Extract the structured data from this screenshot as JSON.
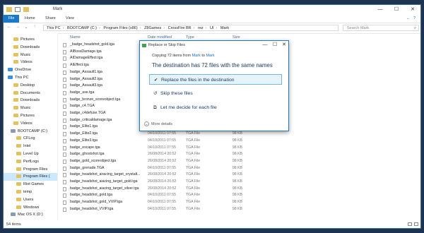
{
  "window": {
    "title": "Mark",
    "controls": {
      "minimize": "—",
      "maximize": "☐",
      "close": "✕"
    }
  },
  "ribbon": {
    "tabs": [
      "File",
      "Home",
      "Share",
      "View"
    ]
  },
  "addressbar": {
    "back": "←",
    "forward": "→",
    "up": "↑",
    "path": [
      "This PC",
      "BOOTCAMP (C:)",
      "Program Files (x86)",
      "Z8Games",
      "CrossFire BR",
      "rez",
      "UI",
      "Mark"
    ],
    "search_placeholder": "Search Mark"
  },
  "nav": {
    "items": [
      {
        "label": "Pictures",
        "icon": "folder"
      },
      {
        "label": "Downloads",
        "icon": "folder"
      },
      {
        "label": "Music",
        "icon": "folder"
      },
      {
        "label": "Videos",
        "icon": "folder"
      },
      {
        "label": "OneDrive",
        "icon": "cloud"
      },
      {
        "label": "This PC",
        "icon": "pc"
      },
      {
        "label": "Desktop",
        "icon": "folder"
      },
      {
        "label": "Documents",
        "icon": "folder"
      },
      {
        "label": "Downloads",
        "icon": "folder"
      },
      {
        "label": "Music",
        "icon": "folder"
      },
      {
        "label": "Pictures",
        "icon": "folder"
      },
      {
        "label": "Videos",
        "icon": "folder"
      },
      {
        "label": "BOOTCAMP (C:)",
        "icon": "drive"
      },
      {
        "label": "CFLog",
        "icon": "folder"
      },
      {
        "label": "Intel",
        "icon": "folder"
      },
      {
        "label": "Level Up",
        "icon": "folder"
      },
      {
        "label": "PerfLogs",
        "icon": "folder"
      },
      {
        "label": "Program Files",
        "icon": "folder"
      },
      {
        "label": "Program Files (",
        "icon": "folder",
        "selected": true
      },
      {
        "label": "Riot Games",
        "icon": "folder"
      },
      {
        "label": "temp",
        "icon": "folder"
      },
      {
        "label": "Users",
        "icon": "folder"
      },
      {
        "label": "Windows",
        "icon": "folder"
      },
      {
        "label": "Mac OS X (D:)",
        "icon": "drive"
      }
    ]
  },
  "columns": {
    "name": "Name",
    "date": "Date modified",
    "type": "Type",
    "size": "Size"
  },
  "files": [
    {
      "name": "_badge_headshot_gold.tga",
      "date": "",
      "type": "",
      "size": ""
    },
    {
      "name": "AIBossDamage.tga",
      "date": "",
      "type": "",
      "size": ""
    },
    {
      "name": "AIDamageEffect.tga",
      "date": "",
      "type": "",
      "size": ""
    },
    {
      "name": "AIEffect.tga",
      "date": "",
      "type": "",
      "size": ""
    },
    {
      "name": "badge_Assault1.tga",
      "date": "",
      "type": "",
      "size": ""
    },
    {
      "name": "badge_Assault2.tga",
      "date": "",
      "type": "",
      "size": ""
    },
    {
      "name": "badge_Assault3.tga",
      "date": "",
      "type": "",
      "size": ""
    },
    {
      "name": "badge_axe.tga",
      "date": "",
      "type": "",
      "size": ""
    },
    {
      "name": "badge_bronze_scoreobject.tga",
      "date": "",
      "type": "",
      "size": ""
    },
    {
      "name": "badge_c4.TGA",
      "date": "",
      "type": "",
      "size": ""
    },
    {
      "name": "badge_c4defuse.TGA",
      "date": "",
      "type": "",
      "size": ""
    },
    {
      "name": "badge_criticaldamage.tga",
      "date": "",
      "type": "",
      "size": ""
    },
    {
      "name": "badge_Elite1.tga",
      "date": "",
      "type": "",
      "size": ""
    },
    {
      "name": "badge_Elite2.tga",
      "date": "04/10/2011 07:55",
      "type": "TGA File",
      "size": "98 KB"
    },
    {
      "name": "badge_Elite3.tga",
      "date": "04/10/2011 07:55",
      "type": "TGA File",
      "size": "98 KB"
    },
    {
      "name": "badge_escape.tga",
      "date": "04/10/2011 07:55",
      "type": "TGA File",
      "size": "98 KB"
    },
    {
      "name": "badge_ghostshot.tga",
      "date": "26/08/2014 20:52",
      "type": "TGA File",
      "size": "98 KB"
    },
    {
      "name": "badge_gold_scoreobject.tga",
      "date": "26/08/2014 20:52",
      "type": "TGA File",
      "size": "98 KB"
    },
    {
      "name": "badge_grenade.TGA",
      "date": "04/10/2011 07:55",
      "type": "TGA File",
      "size": "98 KB"
    },
    {
      "name": "badge_headshot_airacing_target_crystalt...",
      "date": "26/08/2014 20:52",
      "type": "TGA File",
      "size": "98 KB"
    },
    {
      "name": "badge_headshot_aiacing_target_gold.tga",
      "date": "26/08/2014 20:52",
      "type": "TGA File",
      "size": "98 KB"
    },
    {
      "name": "badge_headshot_aiacing_target_silver.tga",
      "date": "26/08/2014 20:52",
      "type": "TGA File",
      "size": "98 KB"
    },
    {
      "name": "badge_headshot_gold.tga",
      "date": "04/10/2011 07:55",
      "type": "TGA File",
      "size": "98 KB"
    },
    {
      "name": "badge_headshot_gold_VVIP.tga",
      "date": "04/10/2011 07:55",
      "type": "TGA File",
      "size": "98 KB"
    },
    {
      "name": "badge_headshot_VVIP.tga",
      "date": "04/10/2011 07:55",
      "type": "TGA File",
      "size": "98 KB"
    }
  ],
  "status": {
    "count": "54 items"
  },
  "dialog": {
    "title": "Replace or Skip Files",
    "copy_prefix": "Copying 72 items from",
    "copy_from": "Mark",
    "copy_mid": "to",
    "copy_to": "Mark",
    "destination_msg": "The destination has 72 files with the same names",
    "options": [
      {
        "glyph": "✔",
        "label": "Replace the files in the destination",
        "highlighted": true
      },
      {
        "glyph": "↺",
        "label": "Skip these files",
        "highlighted": false
      },
      {
        "glyph": "⧉",
        "label": "Let me decide for each file",
        "highlighted": false
      }
    ],
    "more_details": "More details",
    "controls": {
      "minimize": "—",
      "maximize": "☐",
      "close": "✕"
    }
  },
  "colors": {
    "accent": "#1979ca",
    "folder": "#e6c15a",
    "highlight": "#e5f3fb",
    "desktop": "#1e3350"
  }
}
